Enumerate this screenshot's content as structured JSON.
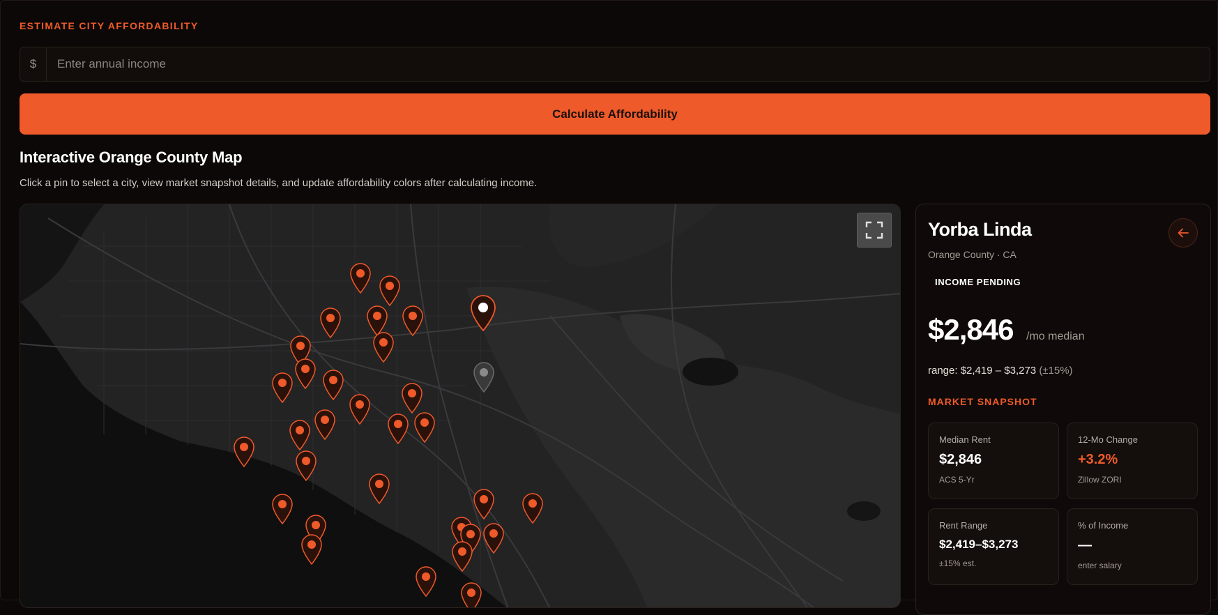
{
  "form": {
    "section_label": "ESTIMATE CITY AFFORDABILITY",
    "currency_prefix": "$",
    "income_placeholder": "Enter annual income",
    "income_value": "",
    "calculate_label": "Calculate Affordability"
  },
  "map": {
    "title": "Interactive Orange County Map",
    "subtitle": "Click a pin to select a city, view market snapshot details, and update affordability colors after calculating income.",
    "fullscreen_icon": "fullscreen-icon",
    "pin_color": "#ef5a2a",
    "selected_pin_color": "#ffffff",
    "inactive_pin_color": "#6b6b6b"
  },
  "panel": {
    "city": "Yorba Linda",
    "location": "Orange County · CA",
    "back_icon": "arrow-left-icon",
    "status_badge": "INCOME PENDING",
    "median_rent": "$2,846",
    "median_unit": "/mo median",
    "range_text": "range: $2,419 – $3,273",
    "range_pct": "(±15%)",
    "snapshot_label": "MARKET SNAPSHOT",
    "cards": [
      {
        "label": "Median Rent",
        "value": "$2,846",
        "note": "ACS 5-Yr"
      },
      {
        "label": "12-Mo Change",
        "value": "+3.2%",
        "note": "Zillow ZORI"
      },
      {
        "label": "Rent Range",
        "value": "$2,419–$3,273",
        "note": "±15% est."
      },
      {
        "label": "% of Income",
        "value": "—",
        "note": "enter salary"
      }
    ]
  }
}
